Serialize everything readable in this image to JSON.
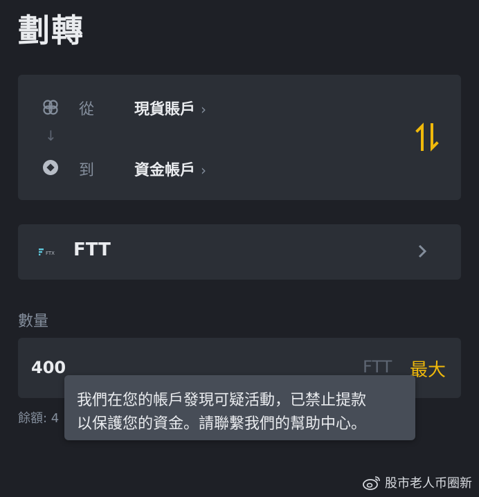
{
  "header": {
    "title": "劃轉"
  },
  "transfer": {
    "from_label": "從",
    "from_account": "現貨賬戶",
    "to_label": "到",
    "to_account": "資金帳戶",
    "down_arrow": "↓",
    "chevron": "›",
    "swap_icon": "swap-vertical-icon"
  },
  "coin": {
    "name": "FTT",
    "logo": "ftx-logo",
    "logo_text": "FTX"
  },
  "amount": {
    "label": "數量",
    "value": "400",
    "unit": "FTT",
    "max_label": "最大"
  },
  "balance": {
    "text": "餘額: 4"
  },
  "toast": {
    "line1": "我們在您的帳戶發現可疑活動，已禁止提款",
    "line2": "以保護您的資金。請聯繫我們的幫助中心。"
  },
  "watermark": {
    "text": "股市老人币圈新",
    "icon": "weibo-icon"
  },
  "colors": {
    "background": "#1e2026",
    "card": "#2b2f36",
    "accent": "#f0b90b",
    "muted": "#848e9c",
    "toast": "#474d57"
  }
}
